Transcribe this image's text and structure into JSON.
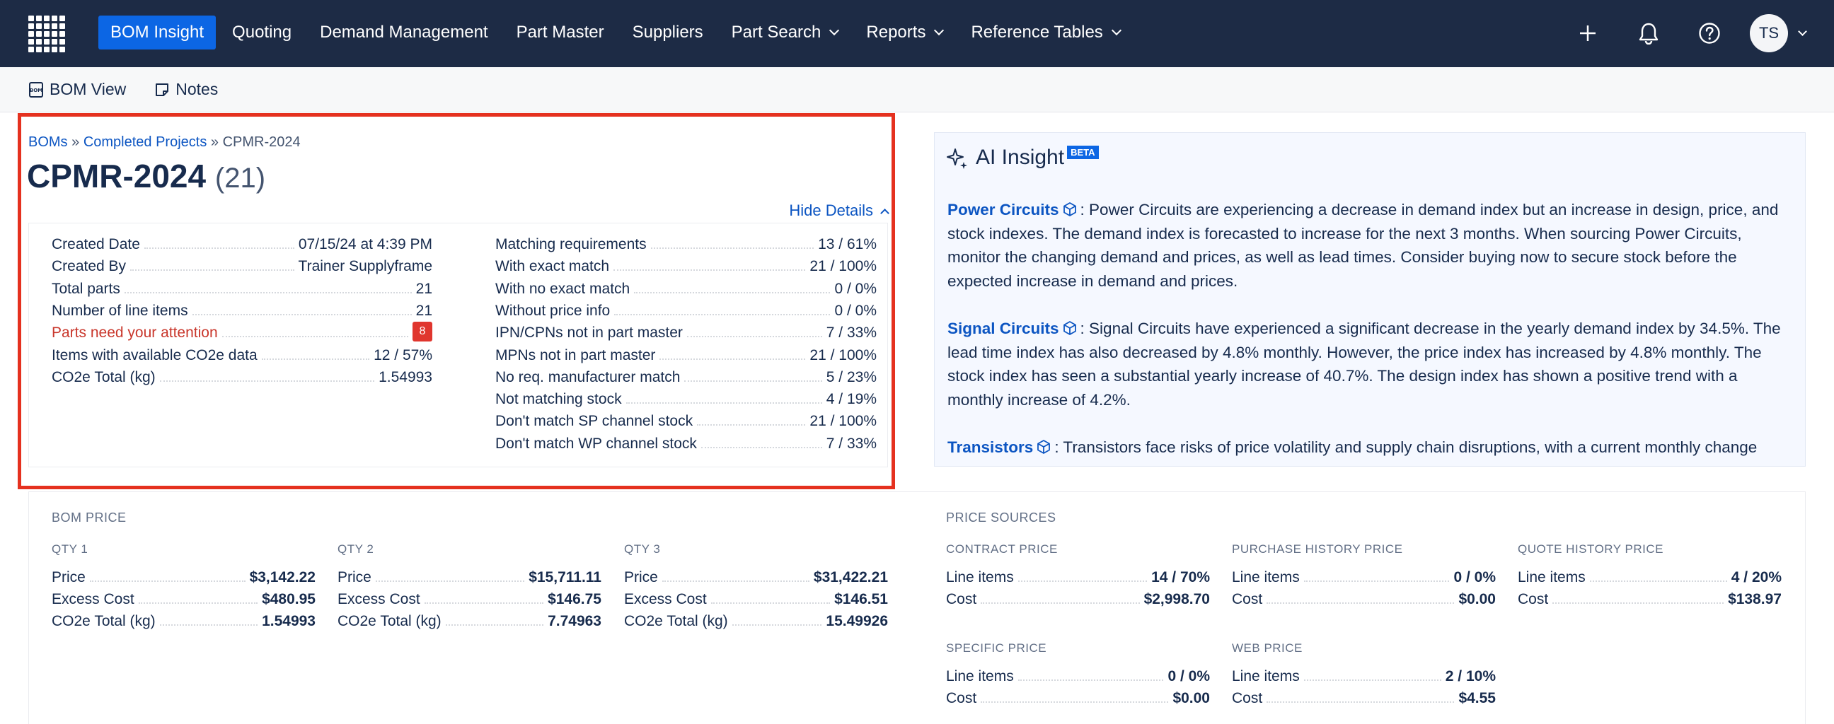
{
  "nav": {
    "items": [
      {
        "label": "BOM Insight",
        "active": true,
        "dropdown": false
      },
      {
        "label": "Quoting",
        "active": false,
        "dropdown": false
      },
      {
        "label": "Demand Management",
        "active": false,
        "dropdown": false
      },
      {
        "label": "Part Master",
        "active": false,
        "dropdown": false
      },
      {
        "label": "Suppliers",
        "active": false,
        "dropdown": false
      },
      {
        "label": "Part Search",
        "active": false,
        "dropdown": true
      },
      {
        "label": "Reports",
        "active": false,
        "dropdown": true
      },
      {
        "label": "Reference Tables",
        "active": false,
        "dropdown": true
      }
    ],
    "avatar_initials": "TS",
    "icons": [
      "plus-icon",
      "bell-icon",
      "help-icon"
    ]
  },
  "toolbar": {
    "bom_view": "BOM View",
    "notes": "Notes"
  },
  "breadcrumb": {
    "boms": "BOMs",
    "sep": "»",
    "completed": "Completed Projects",
    "current": "CPMR-2024"
  },
  "header": {
    "title": "CPMR-2024",
    "count": "(21)",
    "hide_details": "Hide Details"
  },
  "details_left": [
    {
      "k": "Created Date",
      "v": "07/15/24 at 4:39 PM"
    },
    {
      "k": "Created By",
      "v": "Trainer Supplyframe"
    },
    {
      "k": "Total parts",
      "v": "21"
    },
    {
      "k": "Number of line items",
      "v": "21"
    },
    {
      "k": "Parts need your attention",
      "v": "8"
    },
    {
      "k": "Items with available CO2e data",
      "v": "12 / 57%"
    },
    {
      "k": "CO2e Total (kg)",
      "v": "1.54993"
    }
  ],
  "details_right": [
    {
      "k": "Matching requirements",
      "v": "13 / 61%"
    },
    {
      "k": "With exact match",
      "v": "21 / 100%"
    },
    {
      "k": "With no exact match",
      "v": "0 / 0%"
    },
    {
      "k": "Without price info",
      "v": "0 / 0%"
    },
    {
      "k": "IPN/CPNs not in part master",
      "v": "7 / 33%"
    },
    {
      "k": "MPNs not in part master",
      "v": "21 / 100%"
    },
    {
      "k": "No req. manufacturer match",
      "v": "5 / 23%"
    },
    {
      "k": "Not matching stock",
      "v": "4 / 19%"
    },
    {
      "k": "Don't match SP channel stock",
      "v": "21 / 100%"
    },
    {
      "k": "Don't match WP channel stock",
      "v": "7 / 33%"
    }
  ],
  "ai": {
    "title": "AI Insight",
    "beta": "BETA",
    "paragraphs": [
      {
        "name": "Power Circuits",
        "text": ": Power Circuits are experiencing a decrease in demand index but an increase in design, price, and stock indexes. The demand index is forecasted to increase for the next 3 months. When sourcing Power Circuits, monitor the changing demand and prices, as well as lead times. Consider buying now to secure stock before the expected increase in demand and prices."
      },
      {
        "name": "Signal Circuits",
        "text": ": Signal Circuits have experienced a significant decrease in the yearly demand index by 34.5%. The lead time index has also decreased by 4.8% monthly. However, the price index has increased by 4.8% monthly. The stock index has seen a substantial yearly increase of 40.7%. The design index has shown a positive trend with a monthly increase of 4.2%."
      },
      {
        "name": "Transistors",
        "text": ": Transistors face risks of price volatility and supply chain disruptions, with a current monthly change"
      }
    ]
  },
  "bom_price": {
    "title": "BOM PRICE",
    "qtys": [
      {
        "label": "QTY 1",
        "rows": [
          {
            "k": "Price",
            "v": "$3,142.22"
          },
          {
            "k": "Excess Cost",
            "v": "$480.95"
          },
          {
            "k": "CO2e Total (kg)",
            "v": "1.54993"
          }
        ]
      },
      {
        "label": "QTY 2",
        "rows": [
          {
            "k": "Price",
            "v": "$15,711.11"
          },
          {
            "k": "Excess Cost",
            "v": "$146.75"
          },
          {
            "k": "CO2e Total (kg)",
            "v": "7.74963"
          }
        ]
      },
      {
        "label": "QTY 3",
        "rows": [
          {
            "k": "Price",
            "v": "$31,422.21"
          },
          {
            "k": "Excess Cost",
            "v": "$146.51"
          },
          {
            "k": "CO2e Total (kg)",
            "v": "15.49926"
          }
        ]
      }
    ]
  },
  "price_sources": {
    "title": "PRICE SOURCES",
    "sources": [
      {
        "label": "CONTRACT PRICE",
        "rows": [
          {
            "k": "Line items",
            "v": "14 / 70%"
          },
          {
            "k": "Cost",
            "v": "$2,998.70"
          }
        ]
      },
      {
        "label": "PURCHASE HISTORY PRICE",
        "rows": [
          {
            "k": "Line items",
            "v": "0 / 0%"
          },
          {
            "k": "Cost",
            "v": "$0.00"
          }
        ]
      },
      {
        "label": "QUOTE HISTORY PRICE",
        "rows": [
          {
            "k": "Line items",
            "v": "4 / 20%"
          },
          {
            "k": "Cost",
            "v": "$138.97"
          }
        ]
      },
      {
        "label": "SPECIFIC PRICE",
        "rows": [
          {
            "k": "Line items",
            "v": "0 / 0%"
          },
          {
            "k": "Cost",
            "v": "$0.00"
          }
        ]
      },
      {
        "label": "WEB PRICE",
        "rows": [
          {
            "k": "Line items",
            "v": "2 / 10%"
          },
          {
            "k": "Cost",
            "v": "$4.55"
          }
        ]
      }
    ]
  },
  "colors": {
    "nav_bg": "#1d2b45",
    "active": "#0c66e4",
    "highlight_border": "#e5311f",
    "link": "#0c55c2",
    "alert": "#c9372c"
  }
}
